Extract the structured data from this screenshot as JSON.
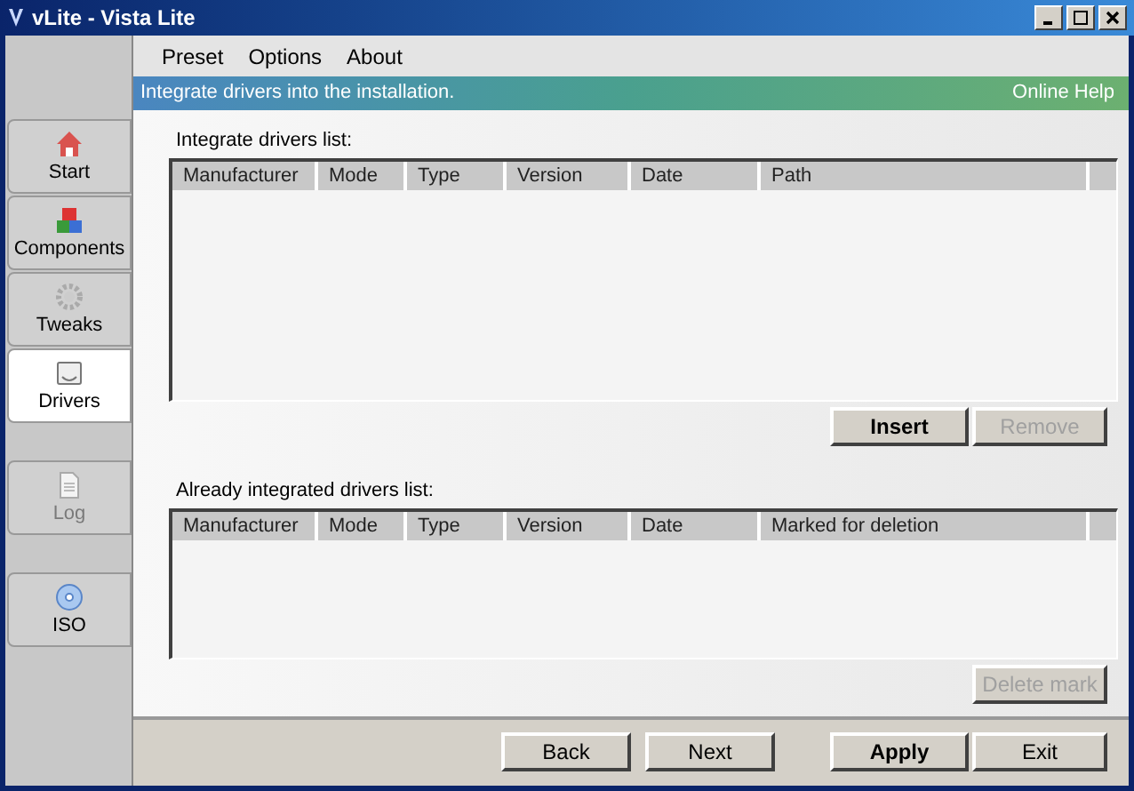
{
  "window": {
    "title": "vLite - Vista Lite"
  },
  "menu": [
    "Preset",
    "Options",
    "About"
  ],
  "banner": {
    "text": "Integrate drivers into the installation.",
    "link": "Online Help"
  },
  "sidebar": {
    "items": [
      {
        "label": "Start",
        "kind": "home",
        "selected": false,
        "disabled": false
      },
      {
        "label": "Components",
        "kind": "blocks",
        "selected": false,
        "disabled": false
      },
      {
        "label": "Tweaks",
        "kind": "gear",
        "selected": false,
        "disabled": false
      },
      {
        "label": "Drivers",
        "kind": "drive",
        "selected": true,
        "disabled": false
      },
      {
        "label": "Log",
        "kind": "document",
        "selected": false,
        "disabled": true
      },
      {
        "label": "ISO",
        "kind": "disc",
        "selected": false,
        "disabled": false
      }
    ]
  },
  "sections": [
    {
      "label": "Integrate drivers list:",
      "columns": [
        "Manufacturer",
        "Mode",
        "Type",
        "Version",
        "Date",
        "Path"
      ],
      "buttons": [
        {
          "label": "Insert",
          "default": true,
          "disabled": false
        },
        {
          "label": "Remove",
          "default": false,
          "disabled": true
        }
      ]
    },
    {
      "label": "Already integrated drivers list:",
      "columns": [
        "Manufacturer",
        "Mode",
        "Type",
        "Version",
        "Date",
        "Marked for deletion"
      ],
      "buttons": [
        {
          "label": "Delete mark",
          "default": false,
          "disabled": true
        }
      ]
    }
  ],
  "footer_buttons": [
    {
      "label": "Back",
      "default": false,
      "disabled": false
    },
    {
      "label": "Next",
      "default": false,
      "disabled": false
    },
    {
      "label": "Apply",
      "default": true,
      "disabled": false
    },
    {
      "label": "Exit",
      "default": false,
      "disabled": false
    }
  ]
}
